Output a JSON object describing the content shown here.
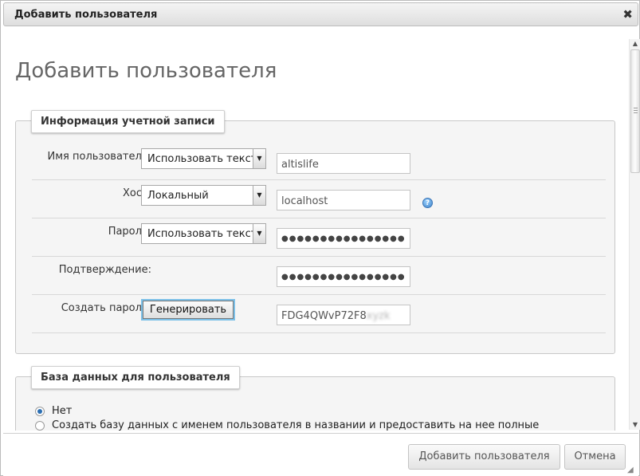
{
  "dialog": {
    "title": "Добавить пользователя",
    "close_glyph": "✖"
  },
  "page": {
    "title": "Добавить пользователя"
  },
  "account_info": {
    "legend": "Информация учетной записи",
    "username": {
      "label": "Имя пользователя:",
      "select_value": "Использовать текст",
      "input_value": "altislife"
    },
    "host": {
      "label": "Хост:",
      "select_value": "Локальный",
      "input_value": "localhost"
    },
    "password": {
      "label": "Пароль:",
      "select_value": "Использовать текст",
      "input_value": "●●●●●●●●●●●●●●●●"
    },
    "confirm": {
      "label": "Подтверждение:",
      "input_value": "●●●●●●●●●●●●●●●●"
    },
    "generate": {
      "label": "Создать пароль:",
      "button_label": "Генерировать",
      "generated_visible": "FDG4QWvP72F8",
      "generated_blurred": "xyzk"
    }
  },
  "database": {
    "legend": "База данных для пользователя",
    "options": [
      {
        "label": "Нет",
        "checked": true
      },
      {
        "label": "Создать базу данных с именем пользователя в названии и предоставить на нее полные",
        "checked": false
      }
    ]
  },
  "footer": {
    "add_button": "Добавить пользователя",
    "cancel_button": "Отмена"
  },
  "icons": {
    "dropdown_arrow": "▼",
    "help": "?",
    "scroll_up": "▲",
    "scroll_down": "▼",
    "resize": "◢"
  },
  "colors": {
    "accent_focus": "#7cc0e8",
    "help_icon": "#3f83c8",
    "radio_selected": "#2c6fb2"
  }
}
